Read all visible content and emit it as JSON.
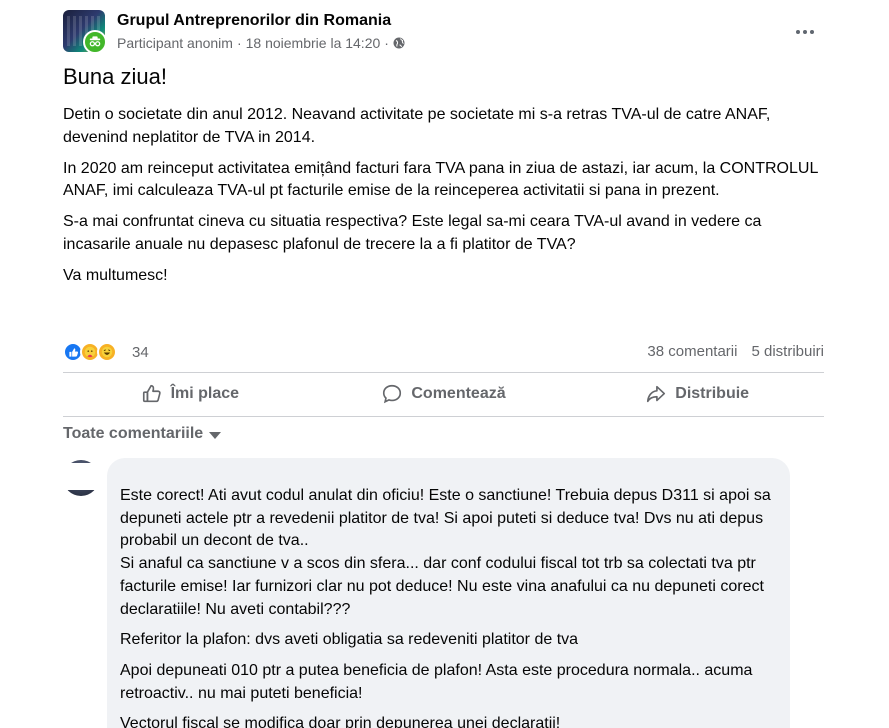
{
  "post": {
    "group_name": "Grupul Antreprenorilor din Romania",
    "author": "Participant anonim",
    "separator": "·",
    "timestamp": "18 noiembrie la 14:20",
    "privacy_icon": "globe-icon",
    "more_icon": "more-horizontal-icon",
    "title": "Buna ziua!",
    "paragraphs": [
      "Detin o societate din anul 2012. Neavand activitate pe societate mi s-a retras TVA-ul de catre ANAF, devenind neplatitor de TVA in 2014.",
      "In 2020 am reinceput activitatea emițând facturi fara TVA pana in ziua de astazi, iar acum, la CONTROLUL ANAF, imi calculeaza TVA-ul pt facturile emise de la reinceperea activitatii si pana in prezent.",
      "S-a mai confruntat cineva cu situatia respectiva? Este legal sa-mi ceara TVA-ul avand in vedere ca incasarile anuale nu depasesc plafonul de trecere la a fi platitor de TVA?",
      "Va multumesc!"
    ]
  },
  "reactions": {
    "icons": [
      "like-icon",
      "care-icon",
      "haha-icon"
    ],
    "count": "34",
    "comments": "38 comentarii",
    "shares": "5 distribuiri"
  },
  "actions": {
    "like": "Îmi place",
    "comment": "Comentează",
    "share": "Distribuie"
  },
  "comments_filter": {
    "label": "Toate comentariile"
  },
  "comment": {
    "paragraphs": [
      "Este corect! Ati avut codul anulat din oficiu! Este o sanctiune! Trebuia depus D311 si apoi sa depuneti actele ptr a revedenii platitor de tva! Si apoi puteti si deduce tva! Dvs nu ati depus probabil un decont de tva..\nSi anaful ca sanctiune v a scos din sfera... dar conf codului fiscal tot trb sa colectati tva ptr facturile emise! Iar furnizori clar nu pot deduce! Nu este vina anafului ca nu depuneti corect declaratiile! Nu aveti contabil???",
      "Referitor la plafon: dvs aveti obligatia sa redeveniti platitor de tva",
      "Apoi depuneati 010 ptr a putea beneficia de plafon! Asta este procedura normala.. acuma retroactiv.. nu mai puteti beneficia!",
      "Vectorul fiscal se modifica doar prin depunerea unei declaratii!"
    ]
  }
}
